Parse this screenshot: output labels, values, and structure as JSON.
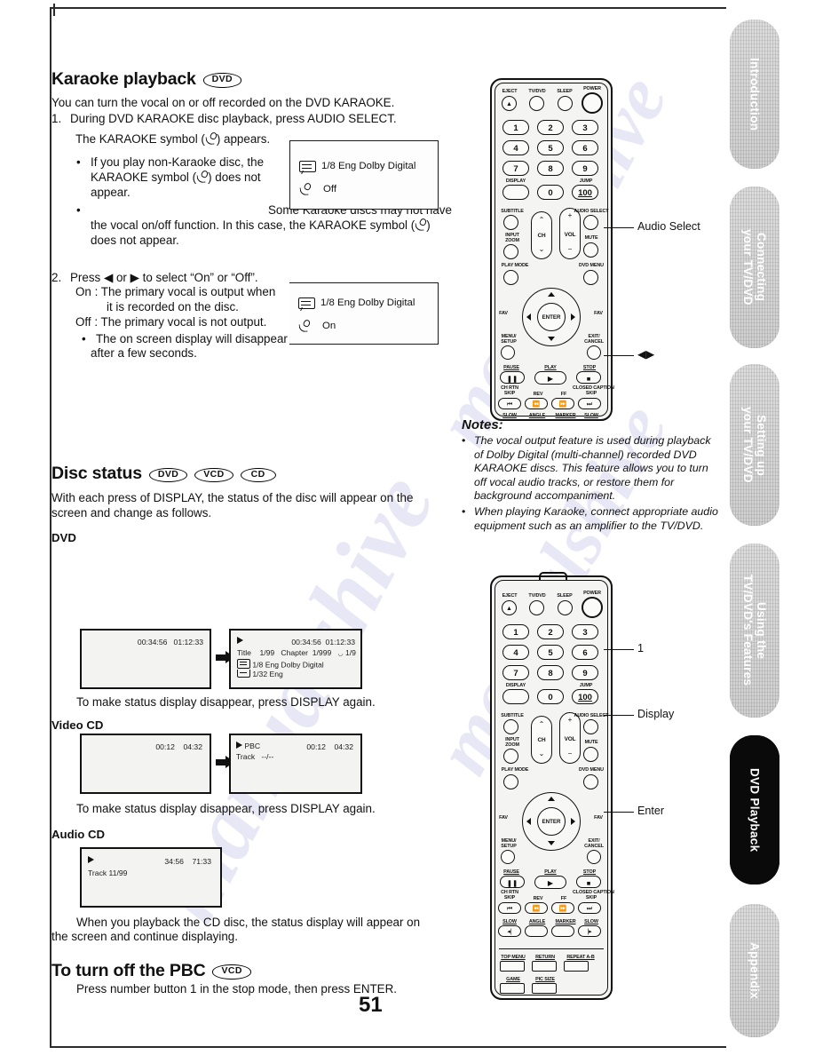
{
  "page": {
    "number": "51",
    "watermark": "manualshive"
  },
  "sections": {
    "karaoke": {
      "title": "Karaoke playback",
      "badges": [
        "DVD"
      ],
      "intro": "You can turn the vocal on or off recorded on the DVD KARAOKE.",
      "step1_num": "1.",
      "step1": "During DVD KARAOKE disc playback, press AUDIO SELECT.",
      "step1_sub_a": "The KARAOKE symbol (",
      "step1_sub_b": ") appears.",
      "bullet1_a": "If you play non-Karaoke disc, the KARAOKE symbol (",
      "bullet1_b": ") does not appear.",
      "bullet2_a": "Some Karaoke discs may not have the vocal on/off function. In this case, the KARAOKE symbol (",
      "bullet2_b": ") does not appear.",
      "step2_num": "2.",
      "step2": "Press ◀ or ▶ to select “On” or “Off”.",
      "on_line1": "On : The primary vocal is output when",
      "on_line2": "it is recorded on the disc.",
      "off_line": "Off : The primary vocal is not output.",
      "bullet3_line1": "The on screen display will disappear",
      "bullet3_line2": "after a few seconds.",
      "osd1": {
        "audio": "1/8 Eng Dolby Digital",
        "vocal": "Off"
      },
      "osd2": {
        "audio": "1/8 Eng Dolby Digital",
        "vocal": "On"
      }
    },
    "disc_status": {
      "title": "Disc status",
      "badges": [
        "DVD",
        "VCD",
        "CD"
      ],
      "intro_line1": "With each press of DISPLAY, the status of the disc will appear on the",
      "intro_line2": "screen and change as follows.",
      "dvd": {
        "label": "DVD",
        "before": {
          "time_elapsed": "00:34:56",
          "time_total": "01:12:33"
        },
        "after": {
          "time_elapsed": "00:34:56",
          "time_total": "01:12:33",
          "title_label": "Title",
          "title_value": "1/99",
          "chapter_label": "Chapter",
          "chapter_value": "1/999",
          "angle_value": "1/9",
          "audio": "1/8  Eng Dolby Digital",
          "subtitle": "1/32  Eng"
        },
        "caption": "To make status display disappear, press DISPLAY again."
      },
      "video_cd": {
        "label": "Video CD",
        "before": {
          "time_elapsed": "00:12",
          "time_total": "04:32"
        },
        "after": {
          "mode": "PBC",
          "time_elapsed": "00:12",
          "time_total": "04:32",
          "track_label": "Track",
          "track_value": "--/--"
        },
        "caption": "To make status display disappear, press DISPLAY again."
      },
      "audio_cd": {
        "label": "Audio CD",
        "screen": {
          "time_elapsed": "34:56",
          "time_total": "71:33",
          "track": "Track 11/99"
        },
        "caption_line1": "When you playback the CD disc, the status display will appear on",
        "caption_line2": "the screen and continue displaying."
      }
    },
    "pbc": {
      "title": "To turn off the PBC",
      "badges": [
        "VCD"
      ],
      "body": "Press number button 1 in the stop mode, then press ENTER."
    }
  },
  "notes": {
    "heading": "Notes:",
    "items": [
      "The vocal output feature is used during playback of Dolby Digital (multi-channel) recorded DVD KARAOKE discs. This feature allows you to turn off vocal audio tracks, or restore them for background accompaniment.",
      "When playing Karaoke, connect appropriate audio equipment such as an amplifier to the TV/DVD."
    ]
  },
  "callouts": {
    "remote1": [
      {
        "label": "Audio Select"
      },
      {
        "label": "◀▶"
      }
    ],
    "remote2": [
      {
        "label": "1"
      },
      {
        "label": "Display"
      },
      {
        "label": "Enter"
      }
    ]
  },
  "remote": {
    "top_labels": [
      "EJECT",
      "TV/DVD",
      "SLEEP",
      "POWER"
    ],
    "keypad": [
      "1",
      "2",
      "3",
      "4",
      "5",
      "6",
      "7",
      "8",
      "9",
      "0"
    ],
    "display_label": "DISPLAY",
    "jump_label": "JUMP",
    "jump_value": "100",
    "mid_labels": {
      "subtitle": "SUBTITLE",
      "input_zoom": "INPUT\nZOOM",
      "ch": "CH",
      "vol": "VOL",
      "audio_select": "AUDIO SELECT",
      "mute": "MUTE",
      "play_mode": "PLAY MODE",
      "dvd_menu": "DVD MENU"
    },
    "nav": {
      "enter": "ENTER",
      "fav_down": "FAV",
      "fav_up": "FAV",
      "menu_setup": "MENU/\nSETUP",
      "exit_cancel": "EXIT/\nCANCEL"
    },
    "transport": {
      "pause": "PAUSE",
      "play": "PLAY",
      "stop": "STOP",
      "ch_rtn_skip": "CH RTN\nSKIP",
      "rev": "REV",
      "ff": "FF",
      "closed_caption_skip": "CLOSED CAPTION\nSKIP",
      "slow_left": "SLOW",
      "angle": "ANGLE",
      "marker": "MARKER",
      "slow_right": "SLOW"
    },
    "bottom": {
      "top_menu": "TOP MENU",
      "return": "RETURN",
      "repeat_ab": "REPEAT A-B",
      "game": "GAME",
      "pic_size": "PIC SIZE"
    }
  },
  "index_tabs": [
    {
      "label": "Introduction",
      "active": false
    },
    {
      "label": "Connecting\nyour TV/DVD",
      "active": false
    },
    {
      "label": "Setting up\nyour TV/DVD",
      "active": false
    },
    {
      "label": "Using the\nTV/DVD's Features",
      "active": false
    },
    {
      "label": "DVD Playback",
      "active": true
    },
    {
      "label": "Appendix",
      "active": false
    }
  ]
}
